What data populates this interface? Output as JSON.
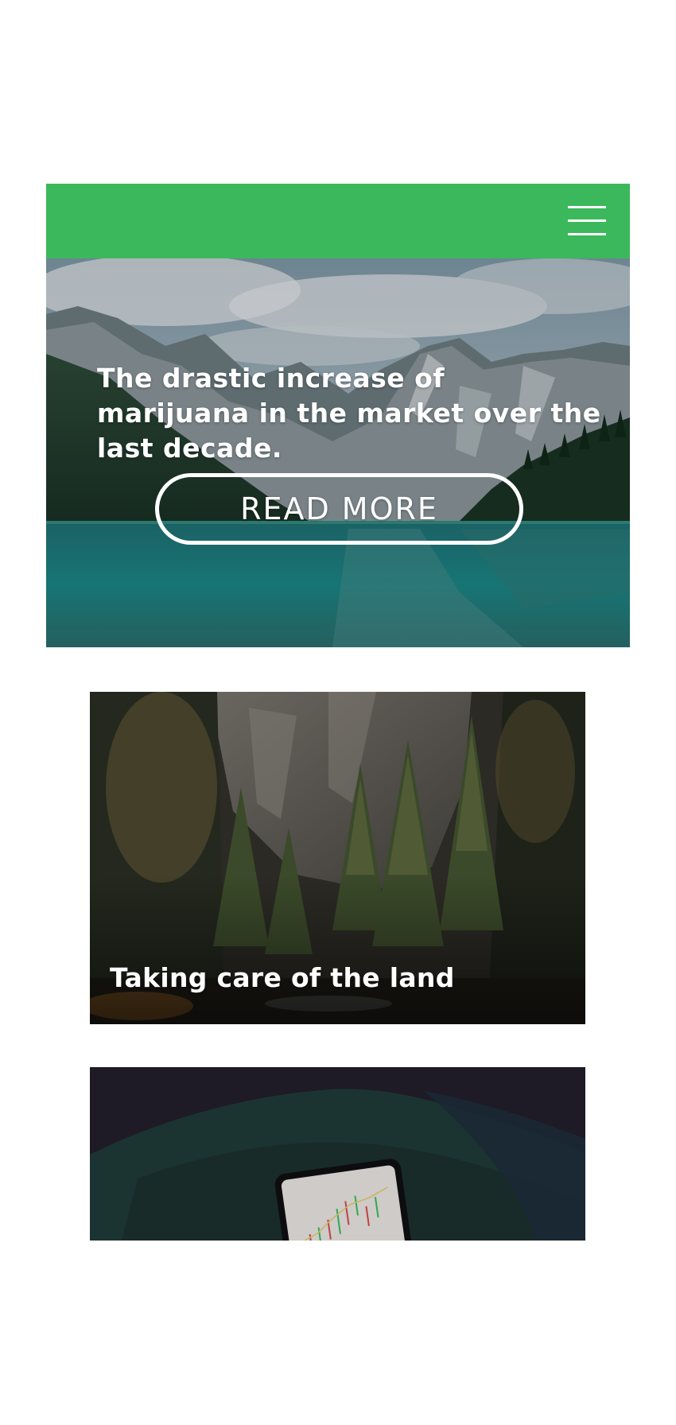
{
  "header": {
    "menu_icon": "hamburger-menu-icon",
    "background_color": "#3cb85c"
  },
  "hero": {
    "title": "The drastic increase of marijuana in the market over the last decade.",
    "button_label": "READ MORE",
    "image": "mountain-lake-image"
  },
  "cards": [
    {
      "title": "Taking care of the land",
      "image": "forest-image"
    },
    {
      "title": "",
      "image": "phone-chart-image"
    }
  ]
}
